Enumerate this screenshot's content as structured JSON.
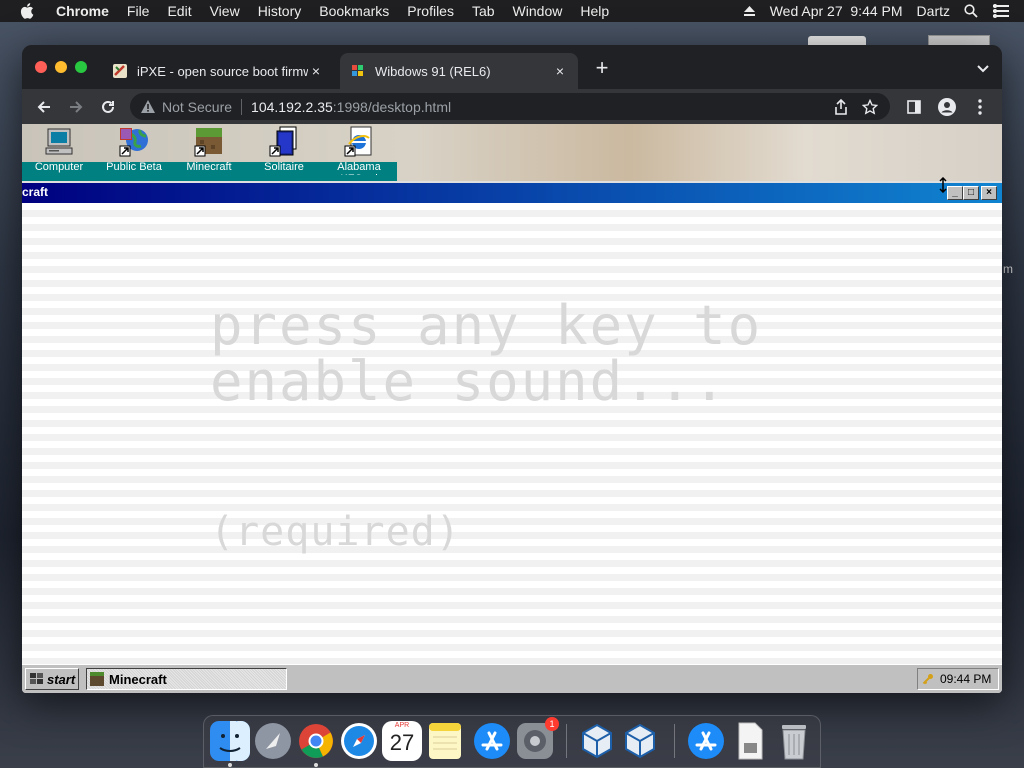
{
  "menubar": {
    "app": "Chrome",
    "items": [
      "File",
      "Edit",
      "View",
      "History",
      "Bookmarks",
      "Profiles",
      "Tab",
      "Window",
      "Help"
    ],
    "datetime": "Wed Apr 27  9:44 PM",
    "user": "Dartz"
  },
  "browser": {
    "tabs": [
      {
        "title": "iPXE - open source boot firmw",
        "close": "×"
      },
      {
        "title": "Wibdows 91 (REL6)",
        "close": "×"
      }
    ],
    "new_tab": "+",
    "security": "Not Secure",
    "url_host": "104.192.2.35",
    "url_path": ":1998/desktop.html"
  },
  "desktop": {
    "icons": [
      {
        "label": "Computer"
      },
      {
        "label": "Public Beta"
      },
      {
        "label": "Minecraft"
      },
      {
        "label": "Solitaire"
      },
      {
        "label": "Alabama KFC.url"
      }
    ]
  },
  "window": {
    "title": "craft",
    "buttons": [
      "_",
      "□",
      "×"
    ],
    "prompt_line1": "press any key to",
    "prompt_line2": "enable sound...",
    "prompt_note": "(required)"
  },
  "taskbar": {
    "start": "start",
    "task": "Minecraft",
    "clock": "09:44 PM"
  },
  "dock": {
    "calendar_month": "APR",
    "calendar_day": "27",
    "badge": "1"
  },
  "colors": {
    "titlebar_start": "#000080",
    "titlebar_end": "#1084d0",
    "desktop_teal": "#008080",
    "chrome_dark": "#202124"
  }
}
